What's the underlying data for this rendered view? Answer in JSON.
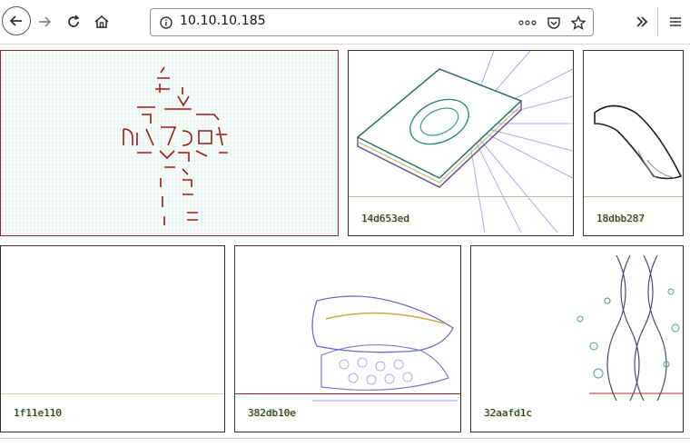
{
  "browser": {
    "url": "10.10.10.185",
    "icons": {
      "back": "back-arrow-icon",
      "forward": "forward-arrow-icon",
      "reload": "reload-icon",
      "home": "home-icon",
      "site_info": "site-info-icon",
      "page_actions": "more-actions-icon",
      "pocket": "pocket-icon",
      "bookmark": "bookmark-star-icon",
      "overflow": "overflow-chevron-icon",
      "menu": "hamburger-menu-icon"
    }
  },
  "gallery": {
    "items": [
      {
        "caption": ""
      },
      {
        "caption": "14d653ed"
      },
      {
        "caption": "18dbb287"
      },
      {
        "caption": "1f11e110"
      },
      {
        "caption": "382db10e"
      },
      {
        "caption": "32aafd1c"
      }
    ]
  }
}
